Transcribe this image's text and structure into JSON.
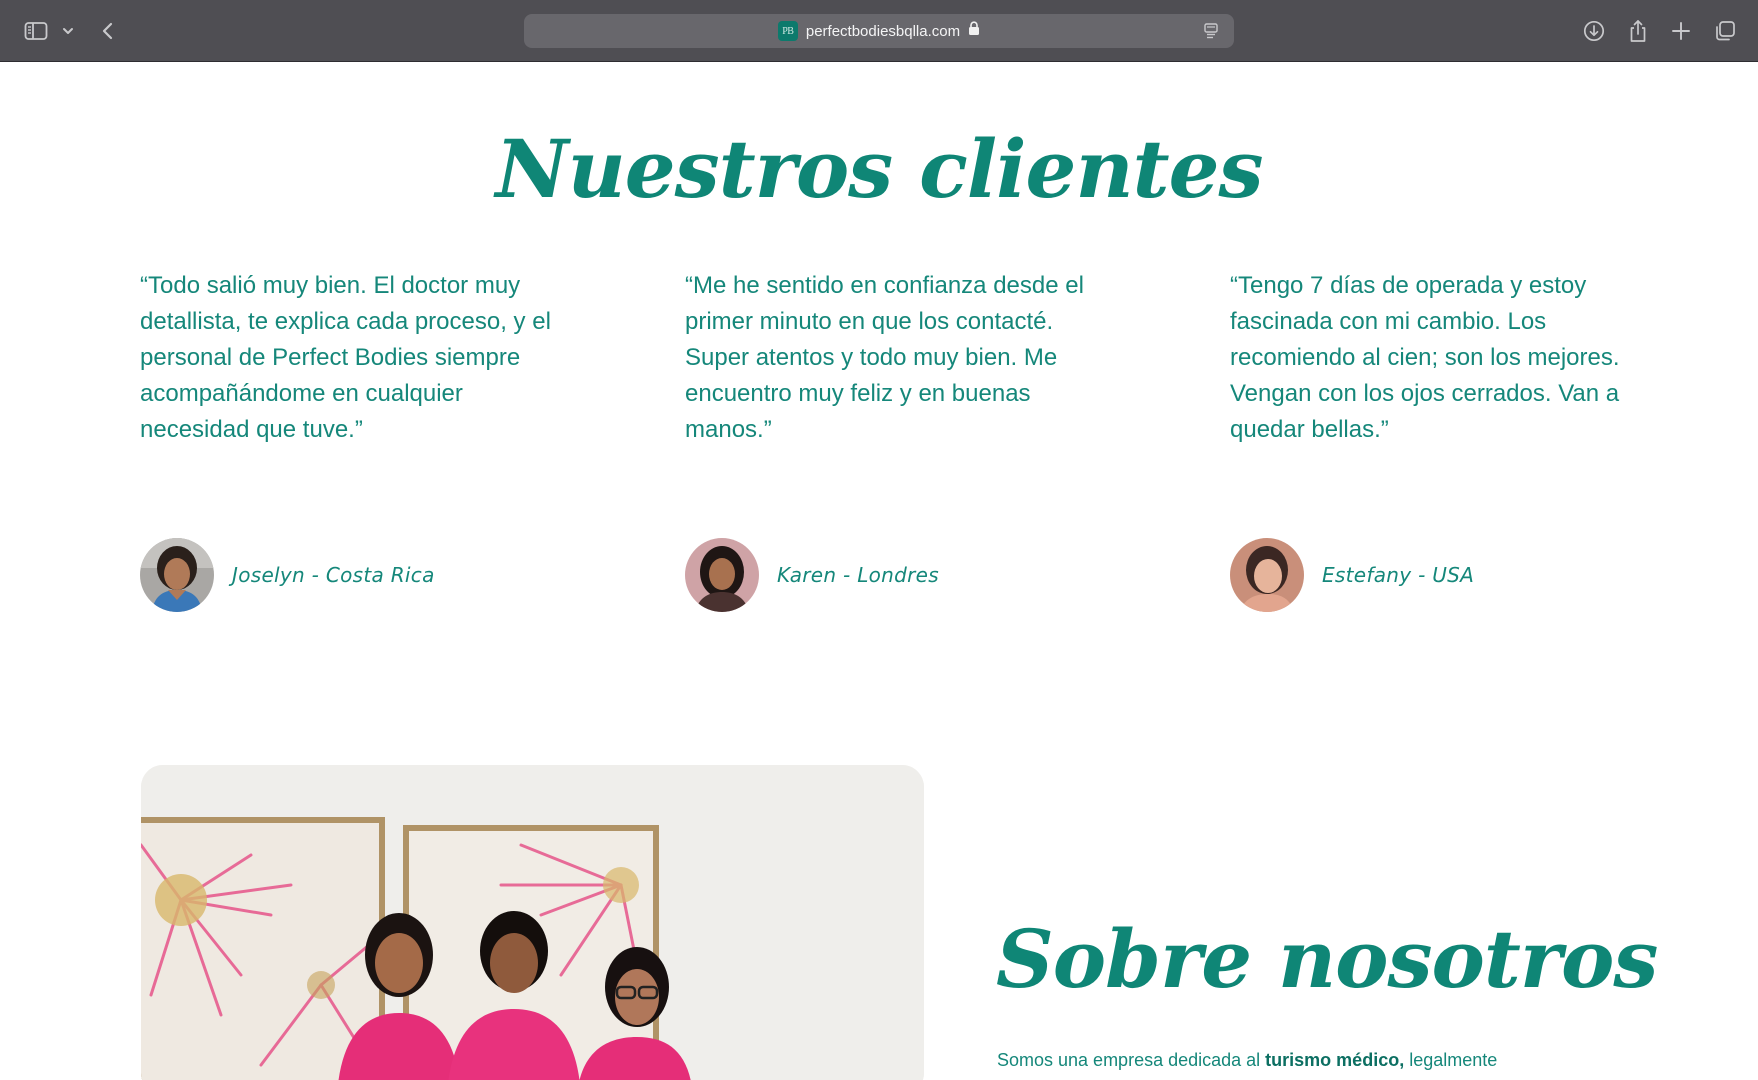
{
  "browser": {
    "url": "perfectbodiesbqlla.com",
    "favicon_text": "PB",
    "icons": {
      "sidebar": "sidebar-icon",
      "tab_group": "chevron-down-icon",
      "back": "back-arrow-icon",
      "lock": "lock-icon",
      "reader": "reader-icon",
      "download": "download-icon",
      "share": "share-icon",
      "new_tab": "plus-icon",
      "tabs": "tab-overview-icon"
    }
  },
  "colors": {
    "accent": "#0f8676",
    "text": "#15877a",
    "chrome": "#4f4e53",
    "address_bar": "#68676c"
  },
  "testimonials_section": {
    "title": "Nuestros clientes",
    "items": [
      {
        "quote": "“Todo salió muy bien. El doctor muy detallista, te explica cada proceso, y el personal de Perfect Bodies siempre acompañándome en cualquier necesidad que tuve.”",
        "author": "Joselyn - Costa Rica"
      },
      {
        "quote": "“Me he sentido en confianza desde el primer minuto en que los contacté. Super atentos y todo muy bien. Me encuentro muy feliz y en buenas manos.”",
        "author": "Karen - Londres"
      },
      {
        "quote": "“Tengo 7 días de operada y estoy fascinada con mi cambio. Los recomiendo al cien; son los mejores. Vengan con los ojos cerrados. Van a quedar bellas.”",
        "author": "Estefany - USA"
      }
    ]
  },
  "about_section": {
    "title": "Sobre nosotros",
    "text_before": "Somos una empresa dedicada al ",
    "text_highlight": "turismo médico,",
    "text_after": " legalmente"
  }
}
